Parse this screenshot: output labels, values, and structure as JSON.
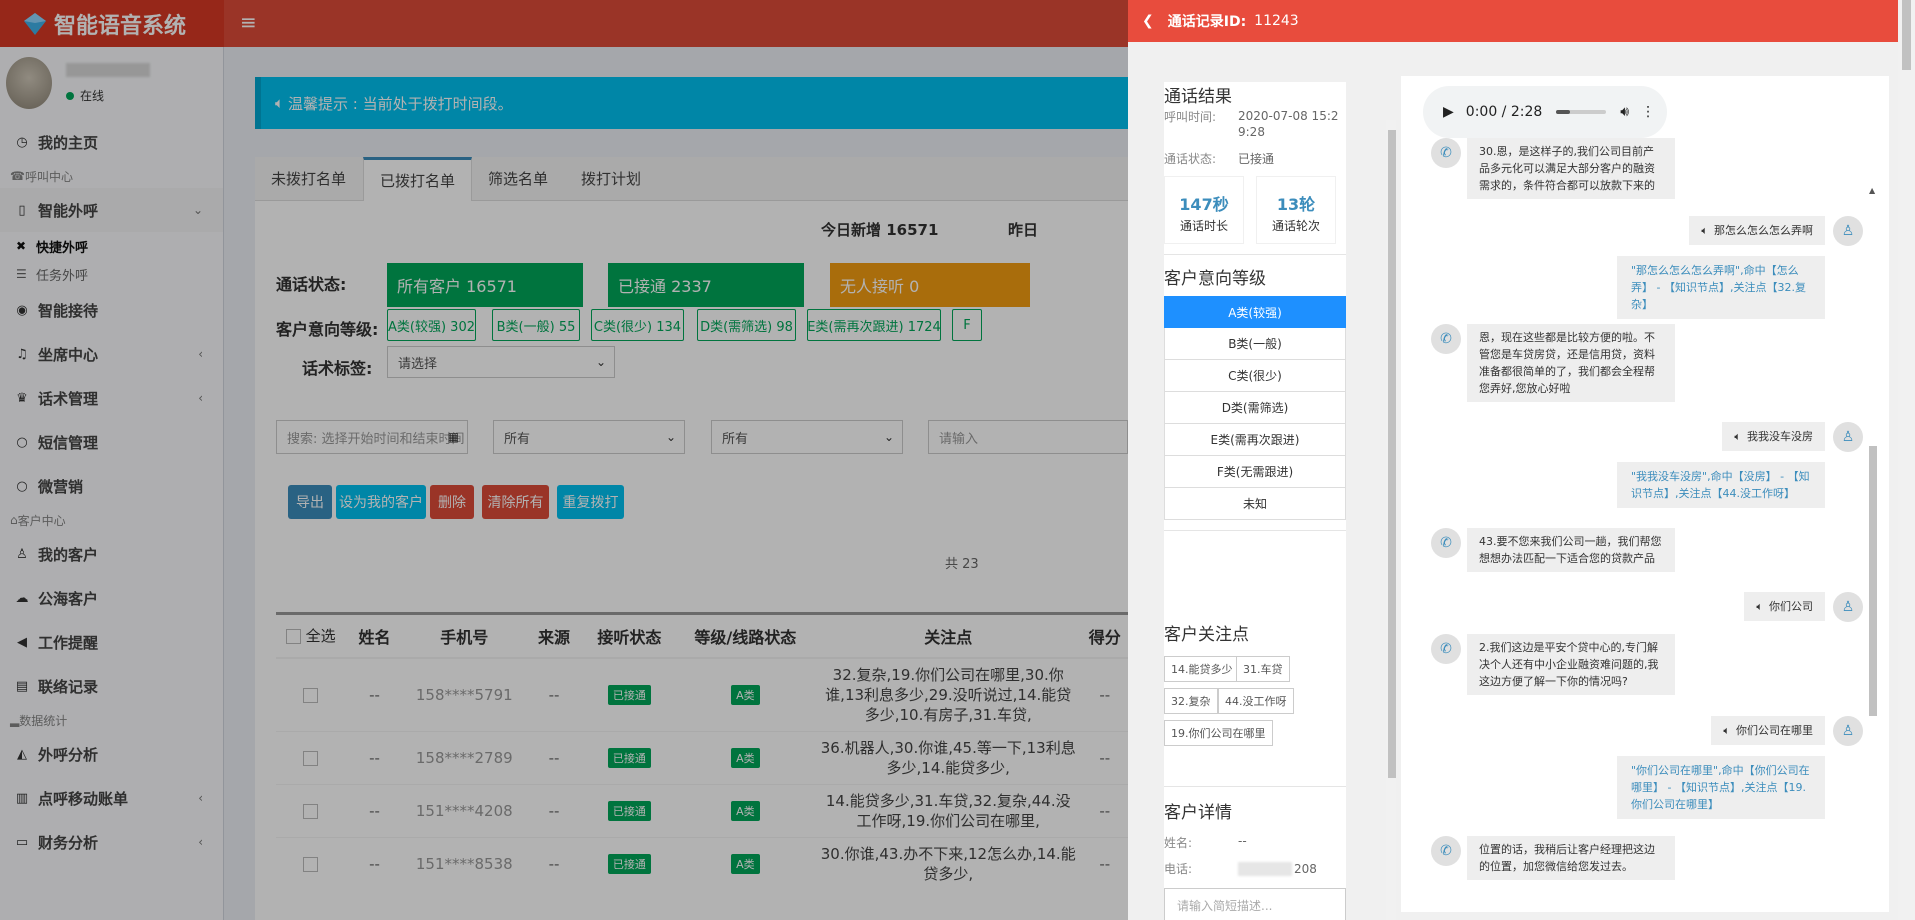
{
  "app": {
    "title": "智能语音系统"
  },
  "user": {
    "status": "在线"
  },
  "sidebar": {
    "items": [
      {
        "label": "我的主页",
        "icon": "dashboard-icon"
      },
      {
        "header": "呼叫中心"
      },
      {
        "label": "智能外呼",
        "icon": "mobile-icon",
        "expanded": true
      },
      {
        "sub": "快捷外呼",
        "icon": "close-x-icon",
        "active": true
      },
      {
        "sub": "任务外呼",
        "icon": "list-icon"
      },
      {
        "label": "智能接待",
        "icon": "eye-icon"
      },
      {
        "label": "坐席中心",
        "icon": "headset-icon"
      },
      {
        "label": "话术管理",
        "icon": "graduation-icon"
      },
      {
        "label": "短信管理",
        "icon": "comment-icon"
      },
      {
        "label": "微营销",
        "icon": "comment-icon"
      },
      {
        "header": "客户中心"
      },
      {
        "label": "我的客户",
        "icon": "user-icon"
      },
      {
        "label": "公海客户",
        "icon": "cloud-icon"
      },
      {
        "label": "工作提醒",
        "icon": "volume-icon"
      },
      {
        "label": "联络记录",
        "icon": "list-icon"
      },
      {
        "header": "数据统计"
      },
      {
        "label": "外呼分析",
        "icon": "area-chart-icon"
      },
      {
        "label": "点呼移动账单",
        "icon": "bar-chart-icon"
      },
      {
        "label": "财务分析",
        "icon": "card-icon"
      }
    ]
  },
  "main": {
    "alert": "温馨提示 : 当前处于拨打时间段。",
    "tabs": [
      "未拨打名单",
      "已拨打名单",
      "筛选名单",
      "拨打计划"
    ],
    "active_tab": 1,
    "stats": {
      "today_new": "今日新增 16571",
      "yesterday": "昨日"
    },
    "call_status_label": "通话状态:",
    "call_status_buttons": [
      {
        "label": "所有客户 16571",
        "color": "#00a65a"
      },
      {
        "label": "已接通 2337",
        "color": "#00a65a"
      },
      {
        "label": "无人接听 0",
        "color": "#f39c12"
      }
    ],
    "intent_label": "客户意向等级:",
    "intent_buttons": [
      "A类(较强) 302",
      "B类(一般) 55",
      "C类(很少) 134",
      "D类(需筛选) 98",
      "E类(需再次跟进) 1724",
      "F"
    ],
    "tag_label": "话术标签:",
    "tag_select": "请选择",
    "search_placeholder": "搜索: 选择开始时间和结束时间",
    "select_a": "所有",
    "select_b": "所有",
    "input_placeholder": "请输入",
    "actions": [
      {
        "label": "导出",
        "color": "#3c8dbc"
      },
      {
        "label": "设为我的客户",
        "color": "#00c0ef"
      },
      {
        "label": "删除",
        "color": "#dd4b39"
      },
      {
        "label": "清除所有",
        "color": "#dd4b39"
      },
      {
        "label": "重复拨打",
        "color": "#00c0ef"
      }
    ],
    "count_text": "共 23",
    "table": {
      "headers": [
        "全选",
        "姓名",
        "手机号",
        "来源",
        "接听状态",
        "等级/线路状态",
        "关注点",
        "得分"
      ],
      "rows": [
        {
          "name": "--",
          "phone": "158****5791",
          "source": "--",
          "status": "已接通",
          "level": "A类",
          "points": "32.复杂,19.你们公司在哪里,30.你谁,13利息多少,29.没听说过,14.能贷多少,10.有房子,31.车贷,",
          "score": "--"
        },
        {
          "name": "--",
          "phone": "158****2789",
          "source": "--",
          "status": "已接通",
          "level": "A类",
          "points": "36.机器人,30.你谁,45.等一下,13利息多少,14.能贷多少,",
          "score": "--"
        },
        {
          "name": "--",
          "phone": "151****4208",
          "source": "--",
          "status": "已接通",
          "level": "A类",
          "points": "14.能贷多少,31.车贷,32.复杂,44.没工作呀,19.你们公司在哪里,",
          "score": "--"
        },
        {
          "name": "--",
          "phone": "151****8538",
          "source": "--",
          "status": "已接通",
          "level": "A类",
          "points": "30.你谁,43.办不下来,12怎么办,14.能贷多少,",
          "score": "--"
        }
      ]
    }
  },
  "drawer": {
    "title": "通话记录ID:",
    "record_id": "11243",
    "result_title": "通话结果",
    "call_time_label": "呼叫时间:",
    "call_time_value": "2020-07-08 15:29:28",
    "call_status_label": "通话状态:",
    "call_status_value": "已接通",
    "duration_value": "147秒",
    "duration_label": "通话时长",
    "rounds_value": "13轮",
    "rounds_label": "通话轮次",
    "level_title": "客户意向等级",
    "levels": [
      "A类(较强)",
      "B类(一般)",
      "C类(很少)",
      "D类(需筛选)",
      "E类(需再次跟进)",
      "F类(无需跟进)",
      "未知"
    ],
    "selected_level": 0,
    "focus_title": "客户关注点",
    "focus_tags": [
      "14.能贷多少",
      "31.车贷",
      "32.复杂",
      "44.没工作呀",
      "19.你们公司在哪里"
    ],
    "detail_title": "客户详情",
    "name_label": "姓名:",
    "name_value": "--",
    "phone_label": "电话:",
    "phone_value": "208",
    "note_placeholder": "请输入简短描述...",
    "audio_time": "0:00 / 2:28",
    "messages": [
      {
        "side": "agent",
        "text": "30.恩，是这样子的,我们公司目前产品多元化可以满足大部分客户的融资需求的，条件符合都可以放款下来的"
      },
      {
        "side": "user",
        "text": "那怎么怎么怎么弄啊"
      },
      {
        "side": "hit",
        "text": "\"那怎么怎么怎么弄啊\",命中【怎么弄】 - 【知识节点】,关注点【32.复杂】"
      },
      {
        "side": "agent",
        "text": "恩，现在这些都是比较方便的啦。不管您是车贷房贷，还是信用贷，资料准备都很简单的了，我们都会全程帮您弄好,您放心好啦"
      },
      {
        "side": "user",
        "text": "我我没车没房"
      },
      {
        "side": "hit",
        "text": "\"我我没车没房\",命中【没房】 - 【知识节点】,关注点【44.没工作呀】"
      },
      {
        "side": "agent",
        "text": "43.要不您来我们公司一趟，我们帮您想想办法匹配一下适合您的贷款产品"
      },
      {
        "side": "user",
        "text": "你们公司"
      },
      {
        "side": "agent",
        "text": "2.我们这边是平安个贷中心的,专门解决个人还有中小企业融资难问题的,我这边方便了解一下你的情况吗?"
      },
      {
        "side": "user",
        "text": "你们公司在哪里"
      },
      {
        "side": "hit",
        "text": "\"你们公司在哪里\",命中【你们公司在哪里】 - 【知识节点】,关注点【19.你们公司在哪里】"
      },
      {
        "side": "agent",
        "text": "位置的话，我稍后让客户经理把这边的位置，加您微信给您发过去。"
      }
    ]
  }
}
